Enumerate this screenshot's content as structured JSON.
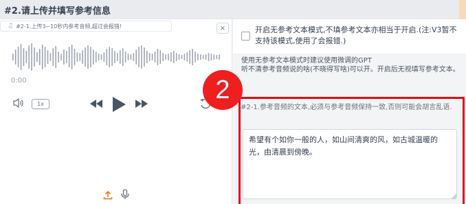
{
  "section": {
    "title": "#2.请上传并填写参考信息"
  },
  "audio": {
    "file_label": "#2-1.上传3~10秒内参考音频,超过会报错!",
    "close": "×",
    "time": "0:00",
    "speed": "1x"
  },
  "option": {
    "text": "开启无参考文本模式,不填参考文本亦相当于开启.(注:V3暂不支持该模式,使用了会报错.)",
    "checked": false
  },
  "info": {
    "line1": "使用无参考文本模式时建议使用微调的GPT",
    "line2": "听不清参考音频说的啥(不晓得写啥)可以开。开启后无视填写参考文本。"
  },
  "badge": {
    "number": "2",
    "color": "#ef1f1f"
  },
  "ref_text": {
    "label": "#2-1.参考音频的文本,必须与参考音频保持一致,否则可能会胡言乱语.",
    "value": "希望有个如你一般的人，如山间清爽的风，如古城温暖的光，由清晨到傍晚。"
  },
  "icons": {
    "file": "music-note-icon",
    "volume": "volume-icon",
    "rewind": "rewind-icon",
    "play": "play-icon",
    "forward": "fast-forward-icon",
    "reset": "reset-icon",
    "upload": "upload-icon",
    "mic": "microphone-icon"
  },
  "colors": {
    "highlight": "#e50914",
    "upload": "#f97316"
  }
}
